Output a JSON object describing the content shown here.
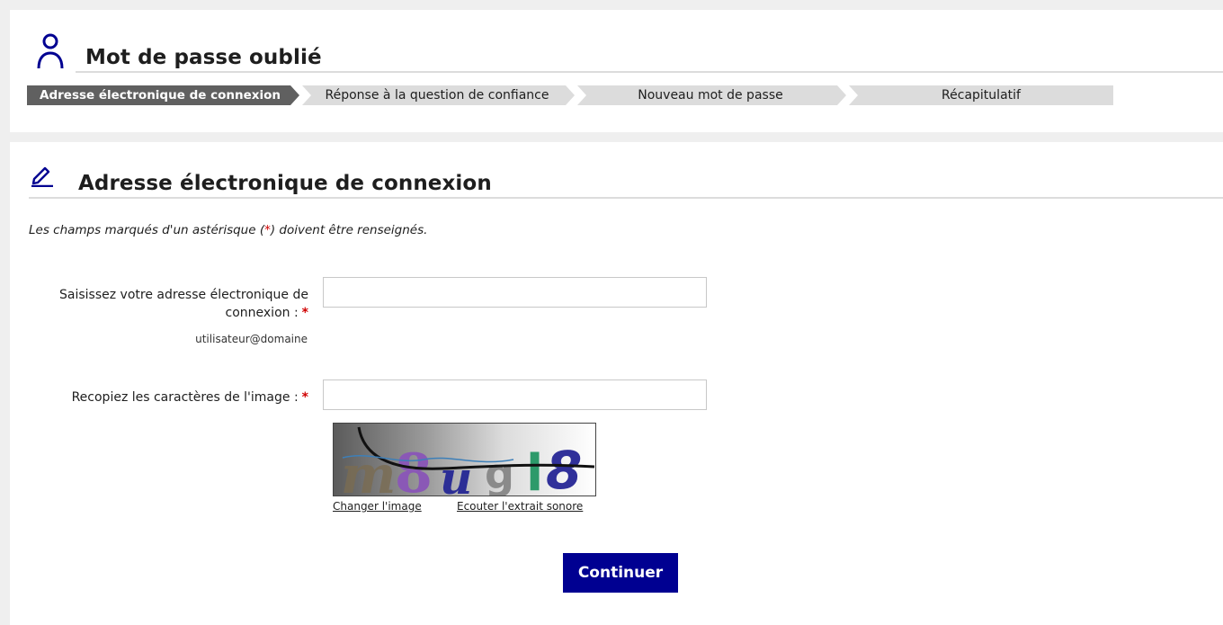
{
  "header": {
    "title": "Mot de passe oublié",
    "icon": "user-icon"
  },
  "stepper": {
    "steps": [
      {
        "label": "Adresse électronique de connexion",
        "active": true
      },
      {
        "label": "Réponse à la question de confiance",
        "active": false
      },
      {
        "label": "Nouveau mot de passe",
        "active": false
      },
      {
        "label": "Récapitulatif",
        "active": false
      }
    ]
  },
  "section": {
    "title": "Adresse électronique de connexion",
    "icon": "pencil-icon"
  },
  "form": {
    "required_hint": {
      "before": "Les champs marqués d'un astérisque (",
      "star": "*",
      "after": ") doivent être renseignés."
    },
    "email": {
      "label": "Saisissez votre adresse électronique de connexion :",
      "star": "*",
      "format_hint": "utilisateur@domaine",
      "value": "",
      "placeholder": ""
    },
    "captcha": {
      "label": "Recopiez les caractères de l'image :",
      "star": "*",
      "value": "",
      "placeholder": "",
      "image_text": "m8ugl8",
      "change_link": "Changer l'image",
      "audio_link": "Ecouter l'extrait sonore"
    },
    "submit_label": "Continuer"
  },
  "colors": {
    "primary": "#000091",
    "active_step": "#606060",
    "inactive_step": "#dcdcdc",
    "required": "#d00000"
  }
}
